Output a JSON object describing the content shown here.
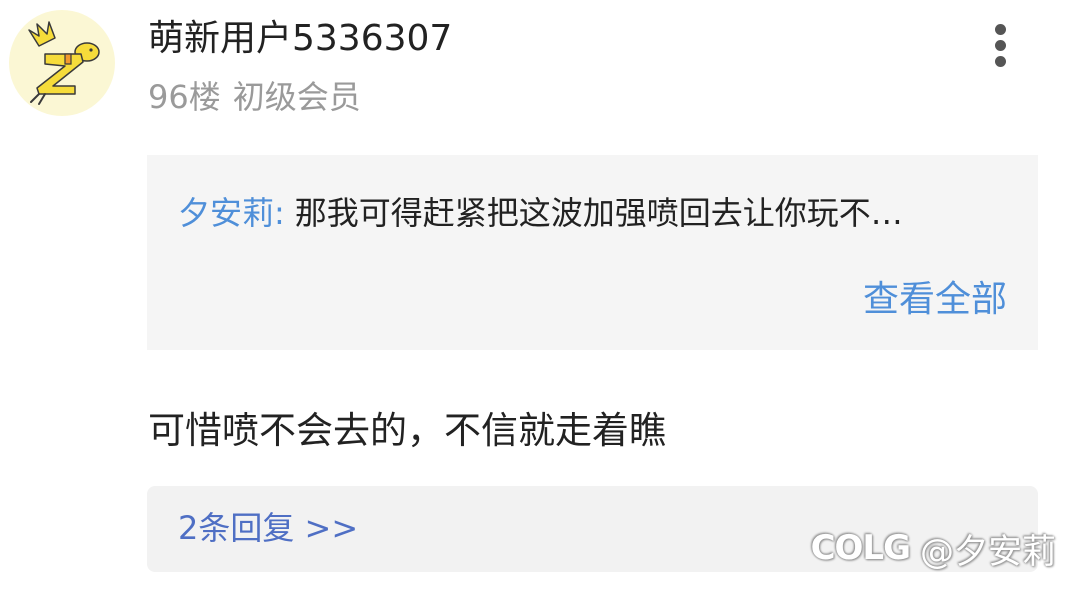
{
  "user": {
    "name": "萌新用户5336307",
    "floor": "96楼",
    "level": "初级会员",
    "avatar_icon": "yellow-cartoon-avatar-icon"
  },
  "menu": {
    "more_icon": "more-vertical-icon"
  },
  "quote": {
    "author": "夕安莉",
    "separator": ":",
    "text": "那我可得赶紧把这波加强喷回去让你玩不…",
    "view_all": "查看全部"
  },
  "comment": {
    "text": "可惜喷不会去的，不信就走着瞧"
  },
  "replies": {
    "label": "2条回复 >>"
  },
  "watermark": {
    "logo": "COLG",
    "text": "@夕安莉"
  },
  "colors": {
    "link_blue": "#4f8fd9",
    "reply_blue": "#4f6fc4",
    "muted_gray": "#9a9a9a",
    "quote_bg": "#f5f5f5",
    "avatar_bg": "#fbf7d4"
  }
}
